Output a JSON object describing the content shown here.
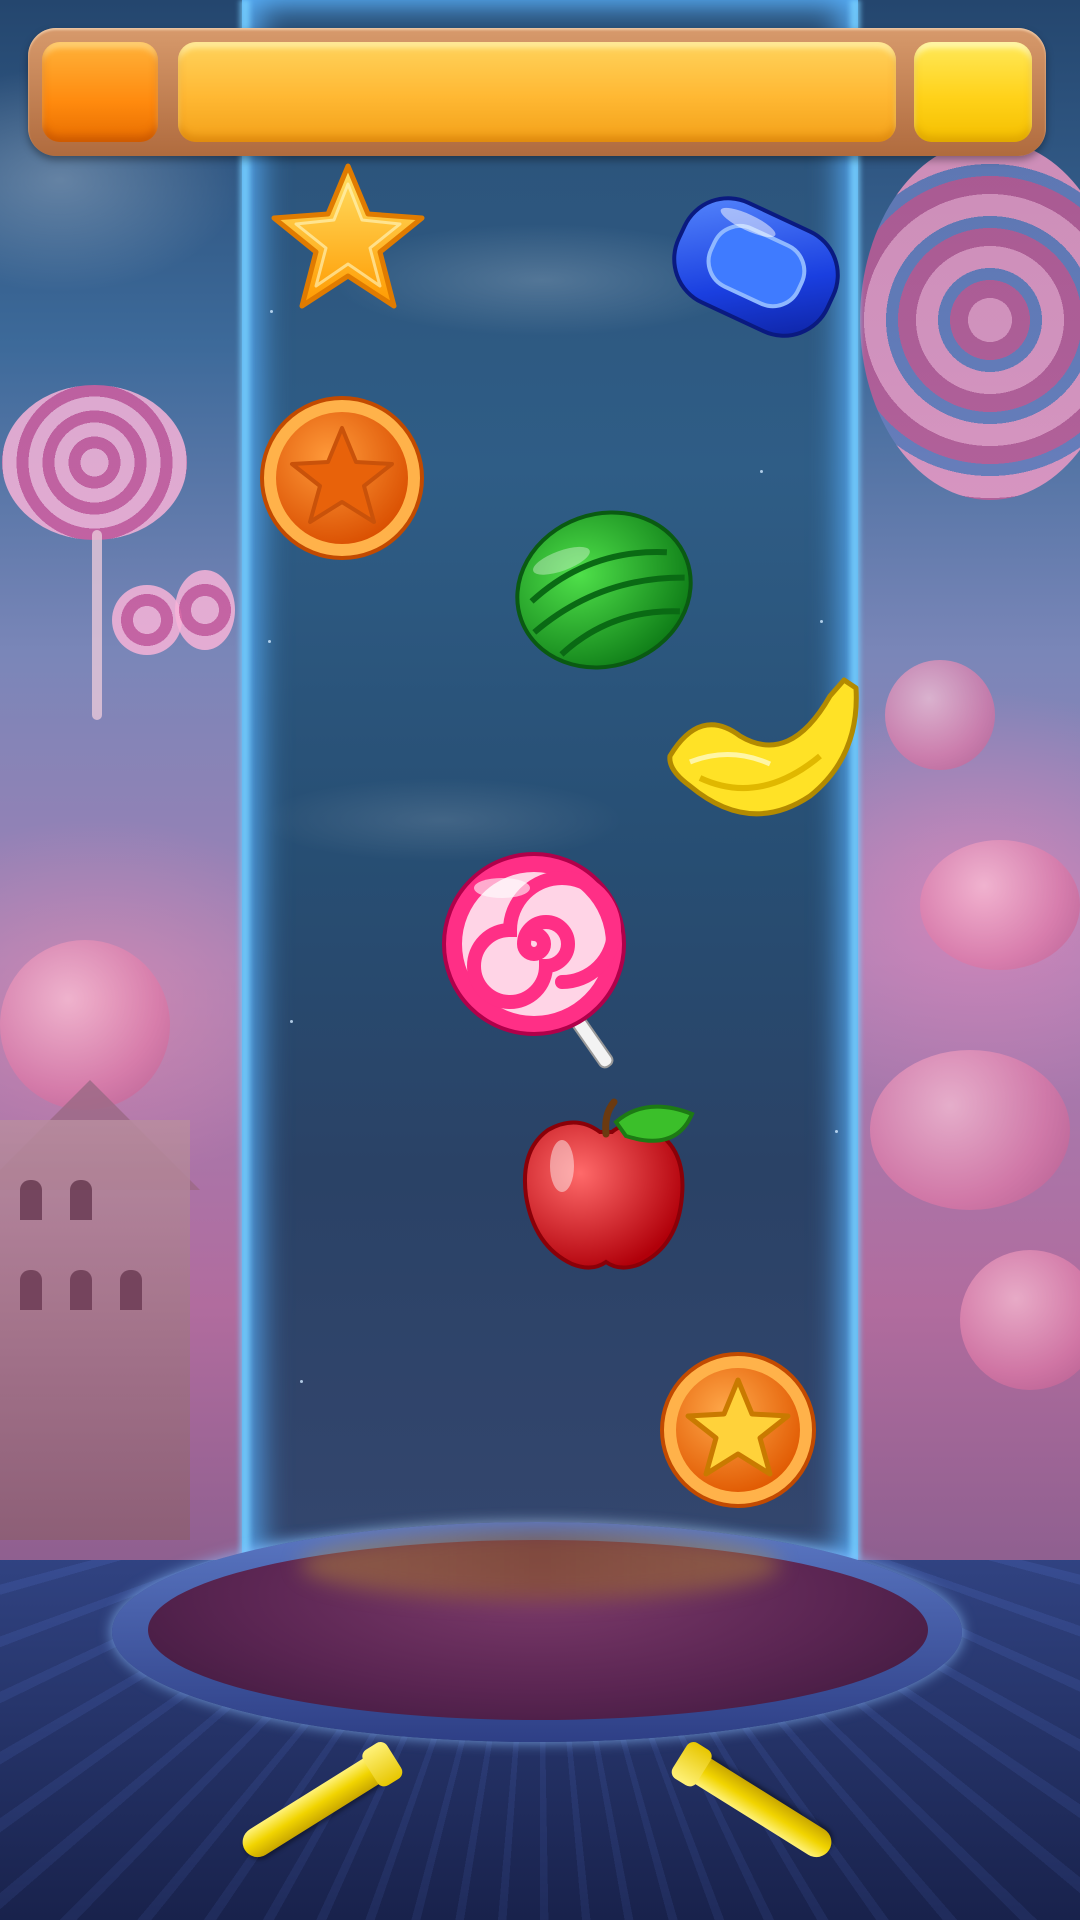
{
  "hud": {
    "left_value": "",
    "center_value": "",
    "right_value": ""
  },
  "falling_items": [
    {
      "name": "gold-star",
      "icon": "star-icon"
    },
    {
      "name": "blue-candy",
      "icon": "blue-candy-icon"
    },
    {
      "name": "orange-star-coin",
      "icon": "star-coin-icon"
    },
    {
      "name": "watermelon",
      "icon": "watermelon-icon"
    },
    {
      "name": "banana",
      "icon": "banana-icon"
    },
    {
      "name": "swirl-lollipop",
      "icon": "lollipop-icon"
    },
    {
      "name": "red-apple",
      "icon": "apple-icon"
    },
    {
      "name": "gold-star-coin",
      "icon": "star-coin-icon"
    }
  ],
  "colors": {
    "lane_glow": "#78c8ff",
    "flipper": "#f1d400",
    "bowl": "#5a2552"
  }
}
